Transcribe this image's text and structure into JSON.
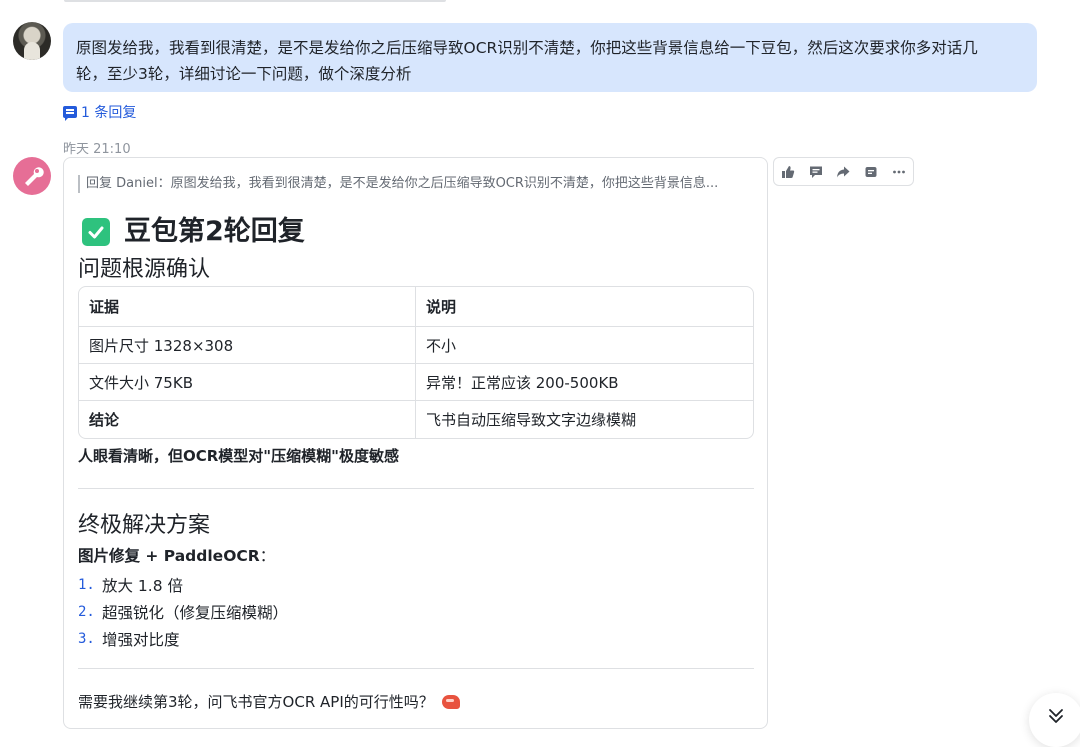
{
  "colors": {
    "user_bubble": "#d7e6fd",
    "link_blue": "#245bdb",
    "check_green": "#2ec27e",
    "bot_avatar": "#e66e96",
    "muted_text": "#8f959e"
  },
  "user_message": {
    "line1": "原图发给我，我看到很清楚，是不是发给你之后压缩导致OCR识别不清楚，你把这些背景信息给一下豆包，然后这次要求你多对话几",
    "line2": "轮，至少3轮，详细讨论一下问题，做个深度分析"
  },
  "thread": {
    "icon": "comment-icon",
    "label": "1 条回复"
  },
  "timestamp": "昨天 21:10",
  "bot_card": {
    "quote": "回复 Daniel：原图发给我，我看到很清楚，是不是发给你之后压缩导致OCR识别不清楚，你把这些背景信息...",
    "title_icon": "check-mark-button-icon",
    "title": "豆包第2轮回复",
    "section1_heading": "问题根源确认",
    "table": {
      "headers": [
        "证据",
        "说明"
      ],
      "rows": [
        [
          "图片尺寸 1328×308",
          "不小"
        ],
        [
          "文件大小 75KB",
          "异常！正常应该 200-500KB"
        ],
        [
          "结论",
          "飞书自动压缩导致文字边缘模糊"
        ]
      ]
    },
    "emphasis_line": "人眼看清晰，但OCR模型对\"压缩模糊\"极度敏感",
    "section2_heading": "终极解决方案",
    "solution_label": "图片修复 + PaddleOCR",
    "solution_colon": "：",
    "steps": [
      {
        "num": "1.",
        "text": "放大 1.8 倍"
      },
      {
        "num": "2.",
        "text": "超强锐化（修复压缩模糊）"
      },
      {
        "num": "3.",
        "text": "增强对比度"
      }
    ],
    "footer_text": "需要我继续第3轮，问飞书官方OCR API的可行性吗？",
    "footer_icon": "shrimp-icon"
  },
  "message_actions": [
    "thumbs-up-icon",
    "comment-icon",
    "forward-icon",
    "quote-reply-icon",
    "more-icon"
  ],
  "scroll_button": "double-chevron-down-icon"
}
